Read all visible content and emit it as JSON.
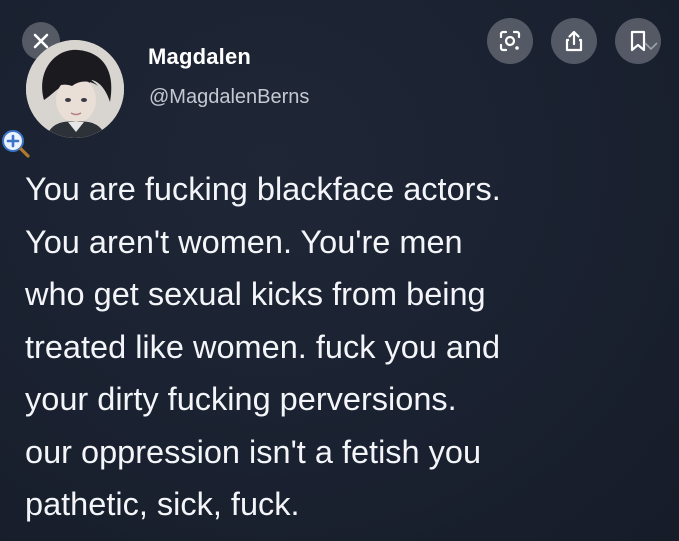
{
  "overlay": {
    "close_icon": "close-icon",
    "actions": [
      {
        "name": "lens-button",
        "icon": "scan-lens-icon"
      },
      {
        "name": "share-button",
        "icon": "share-icon"
      },
      {
        "name": "bookmark-button",
        "icon": "bookmark-icon"
      }
    ]
  },
  "tweet": {
    "display_name": "Magdalen",
    "handle": "@MagdalenBerns",
    "lines": [
      "You are fucking blackface actors.",
      "You aren't women. You're men",
      "who get sexual kicks from being",
      "treated like women. fuck you and",
      "your dirty fucking perversions.",
      "our oppression isn't a fetish you",
      "pathetic, sick, fuck."
    ]
  },
  "colors": {
    "background": "#1b2230",
    "text": "#f3f5f8",
    "handle": "#c4c9d1",
    "button_bg": "#5f646e"
  }
}
